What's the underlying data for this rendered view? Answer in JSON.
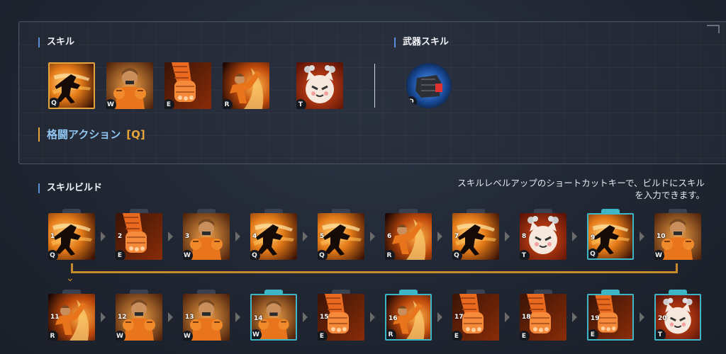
{
  "skills_section": {
    "title": "スキル",
    "skills": [
      {
        "key": "Q",
        "art": "shadow"
      },
      {
        "key": "W",
        "art": "fighter"
      },
      {
        "key": "E",
        "art": "fist"
      },
      {
        "key": "R",
        "art": "kick"
      },
      {
        "key": "T",
        "art": "cat"
      }
    ],
    "selected_key": "Q"
  },
  "weapon_section": {
    "title": "武器スキル",
    "skill": {
      "key": "D",
      "art": "glove"
    }
  },
  "action": {
    "title": "格闘アクション",
    "key_label": "[Q]"
  },
  "build_section": {
    "title": "スキルビルド",
    "hint": "スキルレベルアップのショートカットキーで、ビルドにスキルを入力できます。",
    "steps": [
      {
        "n": "1",
        "key": "Q",
        "art": "shadow",
        "highlight": false
      },
      {
        "n": "2",
        "key": "E",
        "art": "fist",
        "highlight": false
      },
      {
        "n": "3",
        "key": "W",
        "art": "fighter",
        "highlight": false
      },
      {
        "n": "4",
        "key": "Q",
        "art": "shadow",
        "highlight": false
      },
      {
        "n": "5",
        "key": "Q",
        "art": "shadow",
        "highlight": false
      },
      {
        "n": "6",
        "key": "R",
        "art": "kick",
        "highlight": false
      },
      {
        "n": "7",
        "key": "Q",
        "art": "shadow",
        "highlight": false
      },
      {
        "n": "8",
        "key": "T",
        "art": "cat",
        "highlight": false
      },
      {
        "n": "9",
        "key": "Q",
        "art": "shadow",
        "highlight": true
      },
      {
        "n": "10",
        "key": "W",
        "art": "fighter",
        "highlight": false
      },
      {
        "n": "11",
        "key": "R",
        "art": "kick",
        "highlight": false
      },
      {
        "n": "12",
        "key": "W",
        "art": "fighter",
        "highlight": false
      },
      {
        "n": "13",
        "key": "W",
        "art": "fighter",
        "highlight": false
      },
      {
        "n": "14",
        "key": "W",
        "art": "fighter",
        "highlight": true
      },
      {
        "n": "15",
        "key": "E",
        "art": "fist",
        "highlight": false
      },
      {
        "n": "16",
        "key": "R",
        "art": "kick",
        "highlight": true
      },
      {
        "n": "17",
        "key": "E",
        "art": "fist",
        "highlight": false
      },
      {
        "n": "18",
        "key": "E",
        "art": "fist",
        "highlight": false
      },
      {
        "n": "19",
        "key": "E",
        "art": "fist",
        "highlight": true
      },
      {
        "n": "20",
        "key": "T",
        "art": "cat",
        "highlight": true
      }
    ]
  },
  "colors": {
    "accent_gold": "#e4a43a",
    "accent_cyan": "#3fb6c6",
    "title_blue": "#8fc6f2",
    "section_bar": "#5a8fd6"
  }
}
